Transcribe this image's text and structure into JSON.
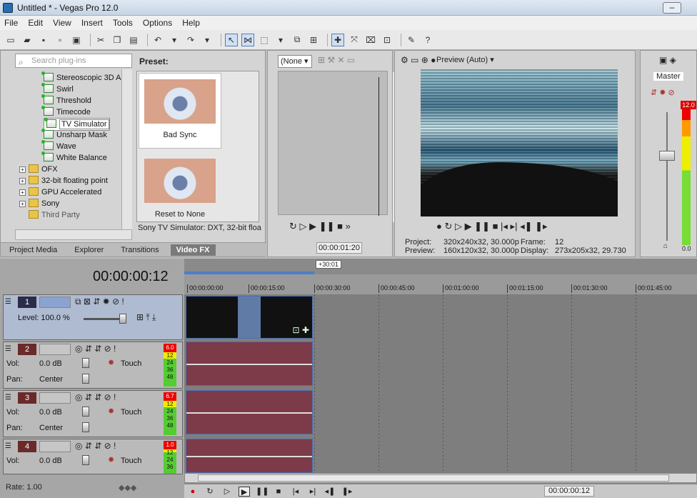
{
  "window": {
    "title": "Untitled * - Vegas Pro 12.0"
  },
  "menu": [
    "File",
    "Edit",
    "View",
    "Insert",
    "Tools",
    "Options",
    "Help"
  ],
  "fx_panel": {
    "search_placeholder": "Search plug-ins",
    "preset_label": "Preset:",
    "tree": [
      {
        "label": "Stereoscopic 3D A",
        "type": "fx"
      },
      {
        "label": "Swirl",
        "type": "fx"
      },
      {
        "label": "Threshold",
        "type": "fx"
      },
      {
        "label": "Timecode",
        "type": "fx"
      },
      {
        "label": "TV Simulator",
        "type": "fx",
        "selected": true
      },
      {
        "label": "Unsharp Mask",
        "type": "fx"
      },
      {
        "label": "Wave",
        "type": "fx"
      },
      {
        "label": "White Balance",
        "type": "fx"
      },
      {
        "label": "OFX",
        "type": "folder"
      },
      {
        "label": "32-bit floating point",
        "type": "folder"
      },
      {
        "label": "GPU Accelerated",
        "type": "folder"
      },
      {
        "label": "Sony",
        "type": "folder"
      },
      {
        "label": "Third Party",
        "type": "folder"
      }
    ],
    "presets": [
      "Bad Sync",
      "Reset to None"
    ],
    "description": "Sony TV Simulator: DXT, 32-bit floa",
    "tabs": [
      "Project Media",
      "Explorer",
      "Transitions",
      "Video FX"
    ],
    "active_tab": "Video FX"
  },
  "trimmer": {
    "select_value": "(None",
    "time": "00:00:01:20"
  },
  "preview": {
    "mode": "Preview (Auto)",
    "project_label": "Project:",
    "project_value": "320x240x32, 30.000p",
    "preview_label": "Preview:",
    "preview_value": "160x120x32, 30.000p",
    "frame_label": "Frame:",
    "frame_value": "12",
    "display_label": "Display:",
    "display_value": "273x205x32, 29.730"
  },
  "master": {
    "label": "Master",
    "level": "12.0",
    "bottom_value": "0.0"
  },
  "timeline": {
    "clock": "00:00:00:12",
    "region_length": "+30:01",
    "ruler": [
      "00:00:00:00",
      "00:00:15:00",
      "00:00:30:00",
      "00:00:45:00",
      "00:01:00:00",
      "00:01:15:00",
      "00:01:30:00",
      "00:01:45:00"
    ],
    "tracks": [
      {
        "num": "1",
        "kind": "video",
        "level_label": "Level: 100.0 %"
      },
      {
        "num": "2",
        "kind": "audio",
        "vol_label": "Vol:",
        "vol_value": "0.0 dB",
        "pan_label": "Pan:",
        "pan_value": "Center",
        "mode": "Touch",
        "peak": "6.0",
        "meter_marks": [
          "12",
          "24",
          "36",
          "48"
        ]
      },
      {
        "num": "3",
        "kind": "audio",
        "vol_label": "Vol:",
        "vol_value": "0.0 dB",
        "pan_label": "Pan:",
        "pan_value": "Center",
        "mode": "Touch",
        "peak": "6.7",
        "meter_marks": [
          "12",
          "24",
          "36",
          "48"
        ]
      },
      {
        "num": "4",
        "kind": "audio",
        "vol_label": "Vol:",
        "vol_value": "0.0 dB",
        "mode": "Touch",
        "peak": "1.0",
        "meter_marks": [
          "12",
          "24",
          "36"
        ]
      }
    ],
    "rate": "Rate: 1.00",
    "transport_time": "00:00:00:12"
  }
}
